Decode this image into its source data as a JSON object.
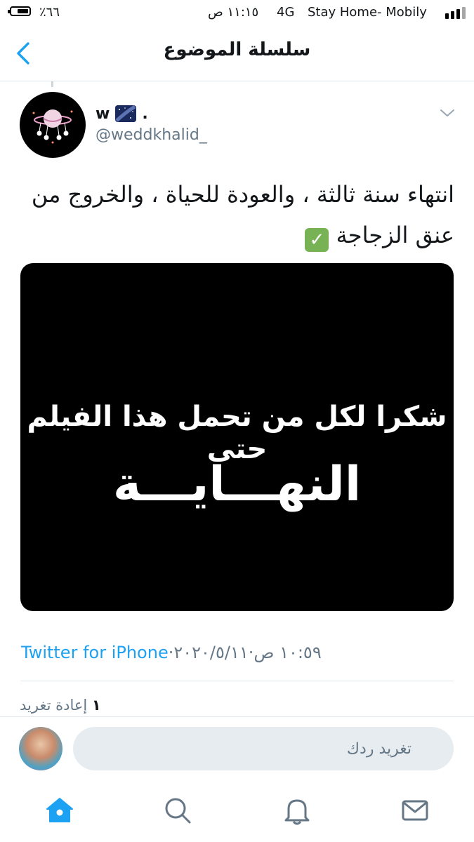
{
  "status_bar": {
    "battery_percent": "٪٦٦",
    "time": "١١:١٥ ص",
    "network": "4G",
    "carrier": "Stay Home- Mobily",
    "battery_level": 0.66
  },
  "nav": {
    "title": "سلسلة الموضوع",
    "back_icon": "chevron-left-icon"
  },
  "tweet": {
    "display_name": "w",
    "name_suffix": ".",
    "name_emoji": "milky-way-emoji",
    "handle": "@weddkhalid_",
    "text": "انتهاء سنة ثالثة ، والعودة للحياة ، والخروج من عنق الزجاجة",
    "text_emoji": "white-check-mark-emoji",
    "media": {
      "line1": "شكرا لكل من تحمل هذا الفيلم حتى",
      "line2": "النهـــايـــة"
    },
    "time": "١٠:٥٩ ص",
    "sep1": " · ",
    "date": "٢٠٢٠/٥/١١",
    "sep2": " · ",
    "source": "Twitter for iPhone",
    "retweet_count": "١",
    "retweet_label": "إعادة تغريد"
  },
  "reply": {
    "placeholder": "تغريد ردك"
  },
  "tabs": [
    {
      "icon": "home-icon",
      "active": true
    },
    {
      "icon": "search-icon",
      "active": false
    },
    {
      "icon": "bell-icon",
      "active": false
    },
    {
      "icon": "mail-icon",
      "active": false
    }
  ],
  "colors": {
    "accent": "#1da1f2",
    "secondary_text": "#657786",
    "border": "#e1e8ed"
  }
}
